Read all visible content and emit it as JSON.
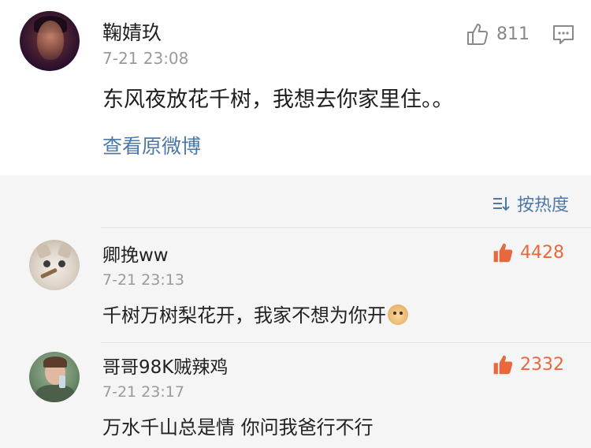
{
  "post": {
    "author": "鞠婧玖",
    "time": "7-21 23:08",
    "text": "东风夜放花千树，我想去你家里住。。",
    "view_link": "查看原微博",
    "likes": "811",
    "avatar_icon": "avatar-icon",
    "like_icon": "thumbs-up-icon",
    "comment_icon": "comment-icon"
  },
  "sort": {
    "label": "按热度",
    "icon": "sort-icon"
  },
  "comments": [
    {
      "author": "卿挽ww",
      "time": "7-21 23:13",
      "text": "千树万树梨花开，我家不想为你开",
      "emoji": "doge-emoji",
      "likes": "4428"
    },
    {
      "author": "哥哥98K贼辣鸡",
      "time": "7-21 23:17",
      "text": "万水千山总是情 你问我爸行不行",
      "likes": "2332"
    }
  ],
  "colors": {
    "link": "#4c78a8",
    "like_active": "#e8683d",
    "muted": "#9a9a9a",
    "comments_bg": "#f5f5f5"
  }
}
